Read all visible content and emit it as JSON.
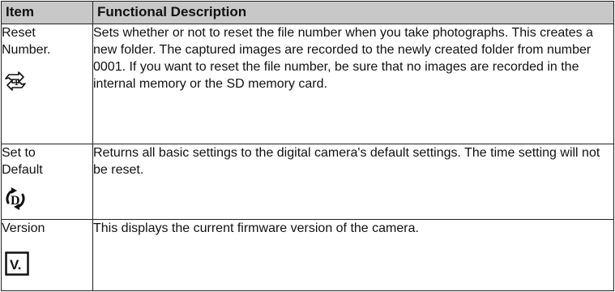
{
  "table": {
    "headers": {
      "item": "Item",
      "description": "Functional Description"
    },
    "rows": [
      {
        "item": "Reset Number.",
        "icon": "reset-number-icon",
        "description": "Sets whether or not to reset the file number when you take photographs. This creates a new folder. The captured images are recorded to the newly created folder from number 0001. If you want to reset the file number, be sure that no images are recorded in the internal memory or the SD memory card."
      },
      {
        "item": "Set to Default",
        "icon": "set-to-default-icon",
        "description": "Returns all basic settings to the digital camera's default settings. The time setting will not be reset."
      },
      {
        "item": "Version",
        "icon": "version-icon",
        "icon_text": "V.",
        "description": "This displays the current firmware version of the camera."
      }
    ]
  },
  "colors": {
    "header_background": "#c8c8c8",
    "border": "#222222",
    "text": "#111111"
  }
}
